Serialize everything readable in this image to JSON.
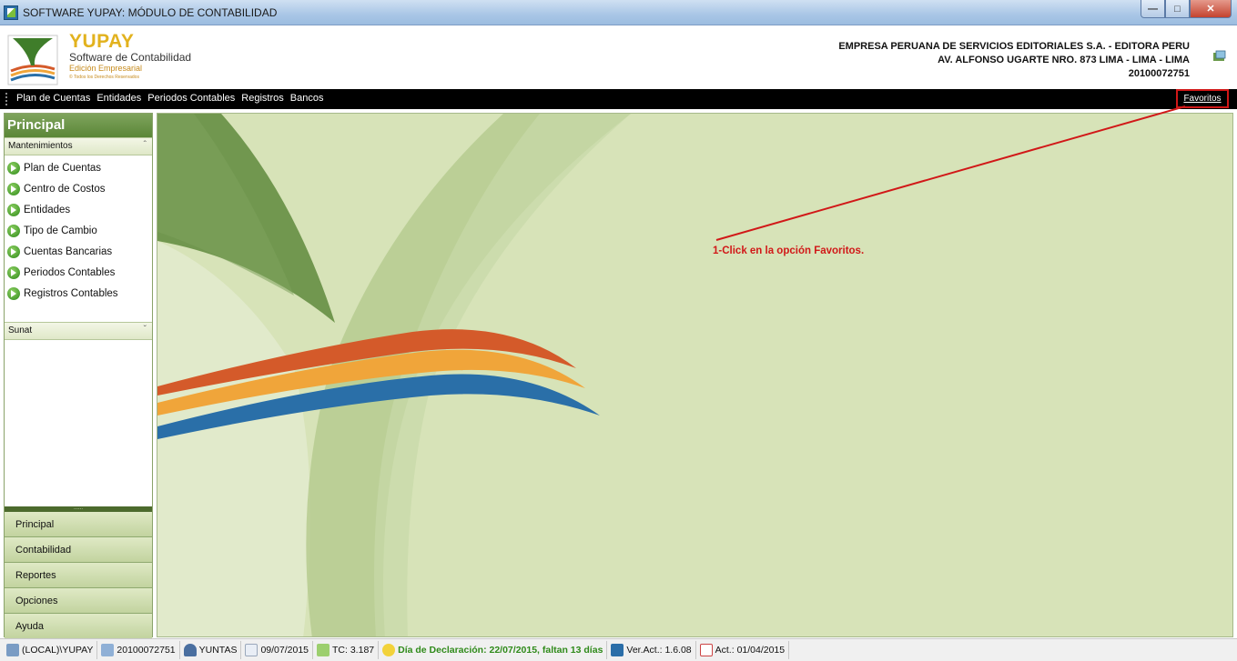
{
  "window": {
    "title": "SOFTWARE YUPAY: MÓDULO DE CONTABILIDAD",
    "controls": [
      "minimize-icon",
      "maximize-icon",
      "close-icon"
    ]
  },
  "header": {
    "logo_title": "YUPAY",
    "logo_subtitle": "Software de Contabilidad",
    "logo_edition": "Edición Empresarial",
    "logo_rights": "© Todos los Derechos Reservados",
    "company_name": "EMPRESA PERUANA DE SERVICIOS EDITORIALES S.A. - EDITORA PERU",
    "company_address": "AV. ALFONSO UGARTE NRO. 873 LIMA - LIMA - LIMA",
    "company_ruc": "20100072751",
    "tool_icon": "settings-tool-icon"
  },
  "menu": {
    "items": [
      "Plan de Cuentas",
      "Entidades",
      "Periodos Contables",
      "Registros",
      "Bancos"
    ],
    "favoritos": "Favoritos"
  },
  "sidebar": {
    "title": "Principal",
    "groups": {
      "mantenimientos": "Mantenimientos",
      "sunat": "Sunat"
    },
    "items": [
      "Plan de Cuentas",
      "Centro de Costos",
      "Entidades",
      "Tipo de Cambio",
      "Cuentas Bancarias",
      "Periodos Contables",
      "Registros Contables"
    ],
    "splitter": "......",
    "nav": [
      "Principal",
      "Contabilidad",
      "Reportes",
      "Opciones",
      "Ayuda"
    ]
  },
  "main": {
    "annotation": "1-Click en la opción Favoritos."
  },
  "statusbar": {
    "server": "(LOCAL)\\YUPAY",
    "ruc": "20100072751",
    "user": "YUNTAS",
    "date": "09/07/2015",
    "tc": "TC: 3.187",
    "declaration": "Día de Declaración: 22/07/2015, faltan 13 días",
    "version": "Ver.Act.: 1.6.08",
    "act": "Act.: 01/04/2015"
  },
  "colors": {
    "accent_green": "#5a8637",
    "background_green": "#d7e3b8",
    "annotation_red": "#d11818",
    "stripe_red": "#d45a2a",
    "stripe_orange": "#f0a53a",
    "stripe_blue": "#2a6fa8"
  }
}
